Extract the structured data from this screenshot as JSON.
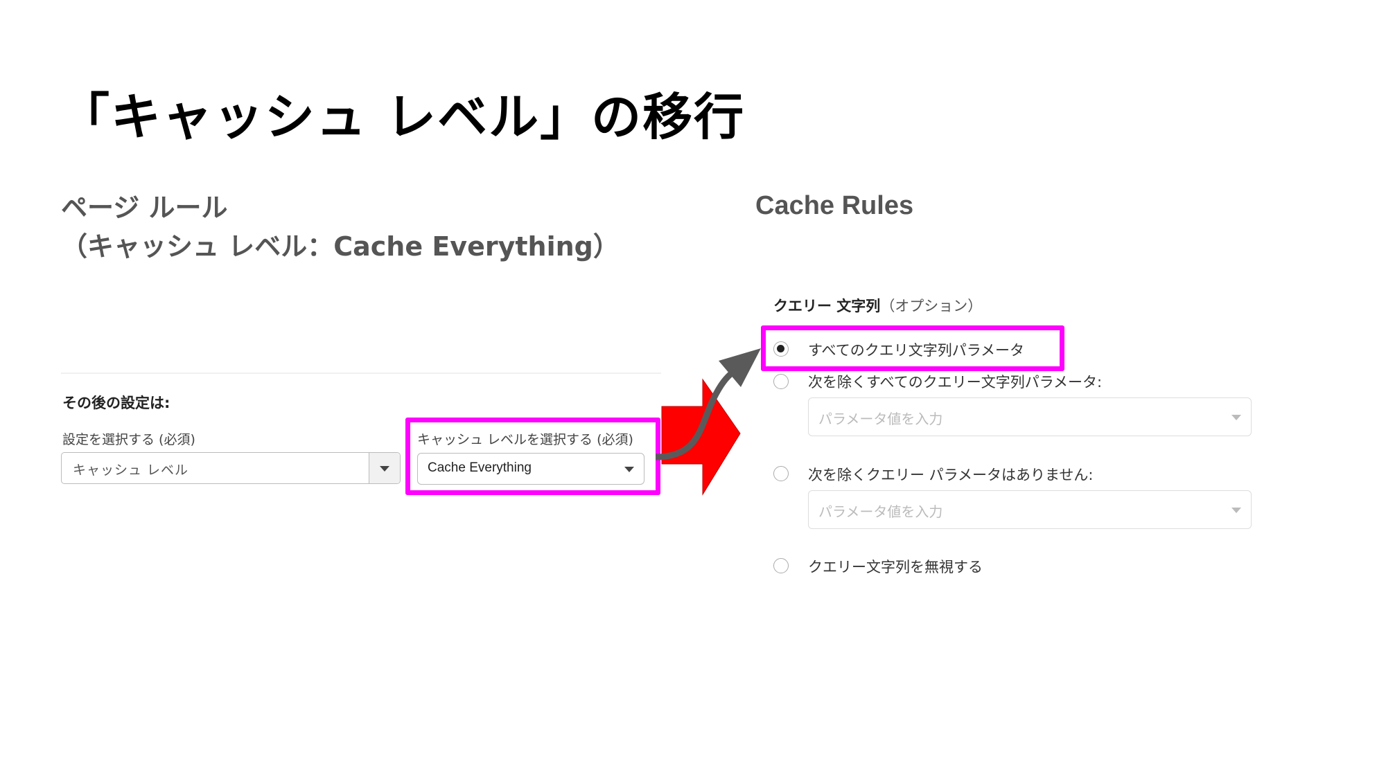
{
  "slide": {
    "title": "「キャッシュ レベル」の移行"
  },
  "left": {
    "heading_line1": "ページ ルール",
    "heading_line2": "（キャッシュ レベル：Cache Everything）",
    "after_label": "その後の設定は:",
    "setting_field": {
      "label": "設定を選択する (必須)",
      "value": "キャッシュ レベル"
    },
    "cache_level_field": {
      "label": "キャッシュ レベルを選択する (必須)",
      "value": "Cache Everything"
    }
  },
  "right": {
    "heading": "Cache Rules",
    "query_string_label": "クエリー 文字列",
    "query_string_optional": "（オプション）",
    "options": [
      {
        "label": "すべてのクエリ文字列パラメータ",
        "selected": true
      },
      {
        "label": "次を除くすべてのクエリー文字列パラメータ:",
        "selected": false,
        "input_placeholder": "パラメータ値を入力"
      },
      {
        "label": "次を除くクエリー パラメータはありません:",
        "selected": false,
        "input_placeholder": "パラメータ値を入力"
      },
      {
        "label": "クエリー文字列を無視する",
        "selected": false
      }
    ]
  },
  "colors": {
    "highlight": "#ff00ff",
    "arrow_red": "#ff0000",
    "arrow_gray": "#5a5a5a"
  }
}
